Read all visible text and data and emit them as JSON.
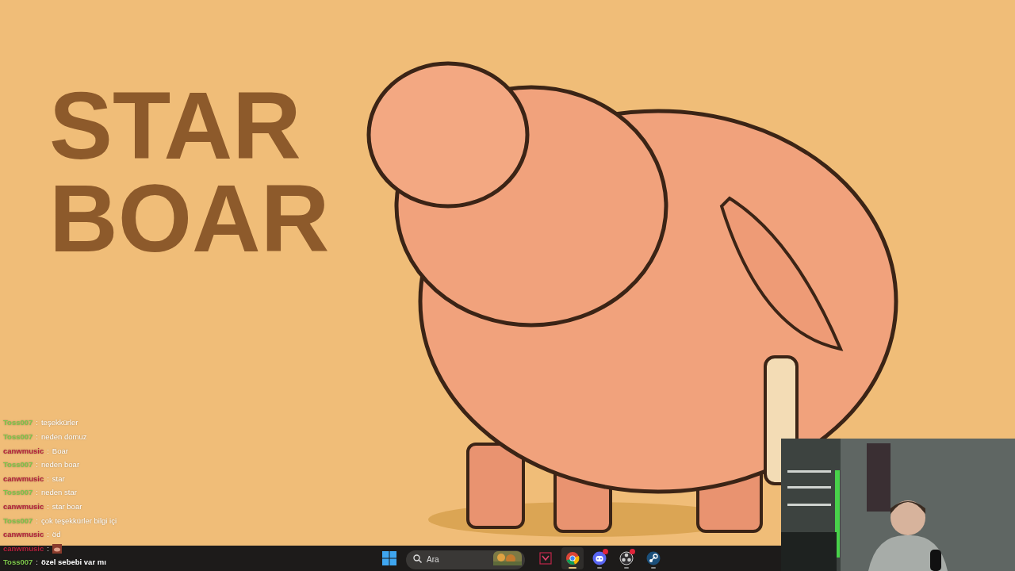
{
  "wallpaper": {
    "title_lines": [
      "STAR",
      "BOAR"
    ],
    "kind": "picture"
  },
  "chat": [
    {
      "user": "Toss007",
      "color": "#7cc64a",
      "separator": ":",
      "kind": "text",
      "message": "teşekkürler"
    },
    {
      "user": "Toss007",
      "color": "#7cc64a",
      "separator": ":",
      "kind": "text",
      "message": "neden domuz"
    },
    {
      "user": "canwmusic",
      "color": "#b5203c",
      "separator": ":",
      "kind": "text",
      "message": "Boar"
    },
    {
      "user": "Toss007",
      "color": "#7cc64a",
      "separator": ":",
      "kind": "text",
      "message": "neden boar"
    },
    {
      "user": "canwmusic",
      "color": "#b5203c",
      "separator": ":",
      "kind": "text",
      "message": "star"
    },
    {
      "user": "Toss007",
      "color": "#7cc64a",
      "separator": ":",
      "kind": "text",
      "message": "neden star"
    },
    {
      "user": "canwmusic",
      "color": "#b5203c",
      "separator": ":",
      "kind": "text",
      "message": "star boar"
    },
    {
      "user": "Toss007",
      "color": "#7cc64a",
      "separator": ":",
      "kind": "text",
      "message": "çok teşekkürler bilgi içi"
    },
    {
      "user": "canwmusic",
      "color": "#b5203c",
      "separator": ":",
      "kind": "text",
      "message": "öd"
    },
    {
      "user": "canwmusic",
      "color": "#b5203c",
      "separator": ":",
      "kind": "emote"
    },
    {
      "user": "Toss007",
      "color": "#7cc64a",
      "separator": ":",
      "kind": "text",
      "message": "özel sebebi var mı"
    }
  ],
  "taskbar": {
    "search": {
      "placeholder": "Ara"
    },
    "apps": [
      {
        "kind": "game",
        "selected": false,
        "notification": false,
        "running": false
      },
      {
        "kind": "browser",
        "selected": true,
        "notification": false,
        "running": true
      },
      {
        "kind": "chat",
        "selected": false,
        "notification": true,
        "running": true
      },
      {
        "kind": "recorder",
        "selected": false,
        "notification": true,
        "running": true
      },
      {
        "kind": "store",
        "selected": false,
        "notification": false,
        "running": true
      }
    ]
  }
}
